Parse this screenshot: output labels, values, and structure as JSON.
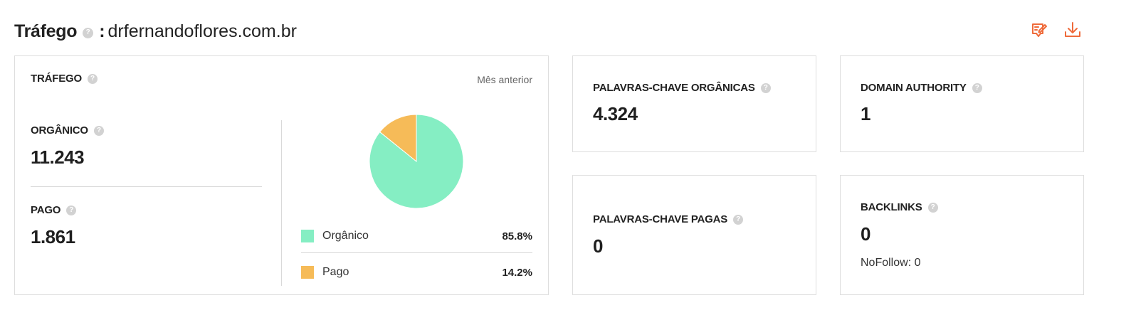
{
  "header": {
    "title": "Tráfego",
    "separator": ":",
    "domain": "drfernandoflores.com.br"
  },
  "traffic": {
    "label": "TRÁFEGO",
    "period": "Mês anterior",
    "organic": {
      "label": "ORGÂNICO",
      "value": "11.243"
    },
    "paid": {
      "label": "PAGO",
      "value": "1.861"
    },
    "chart_data": {
      "type": "pie",
      "slices": [
        {
          "name": "Orgânico",
          "value": 85.8,
          "label": "85.8%",
          "color": "#85eec3"
        },
        {
          "name": "Pago",
          "value": 14.2,
          "label": "14.2%",
          "color": "#f6bb58"
        }
      ]
    }
  },
  "organic_keywords": {
    "label": "PALAVRAS-CHAVE ORGÂNICAS",
    "value": "4.324"
  },
  "domain_authority": {
    "label": "DOMAIN AUTHORITY",
    "value": "1"
  },
  "paid_keywords": {
    "label": "PALAVRAS-CHAVE PAGAS",
    "value": "0"
  },
  "backlinks": {
    "label": "BACKLINKS",
    "value": "0",
    "nofollow": "NoFollow: 0"
  },
  "icons": {
    "help": "?",
    "edit": "edit-report-icon",
    "download": "download-icon"
  },
  "colors": {
    "accent": "#ef6b3b",
    "organic": "#85eec3",
    "paid": "#f6bb58"
  }
}
